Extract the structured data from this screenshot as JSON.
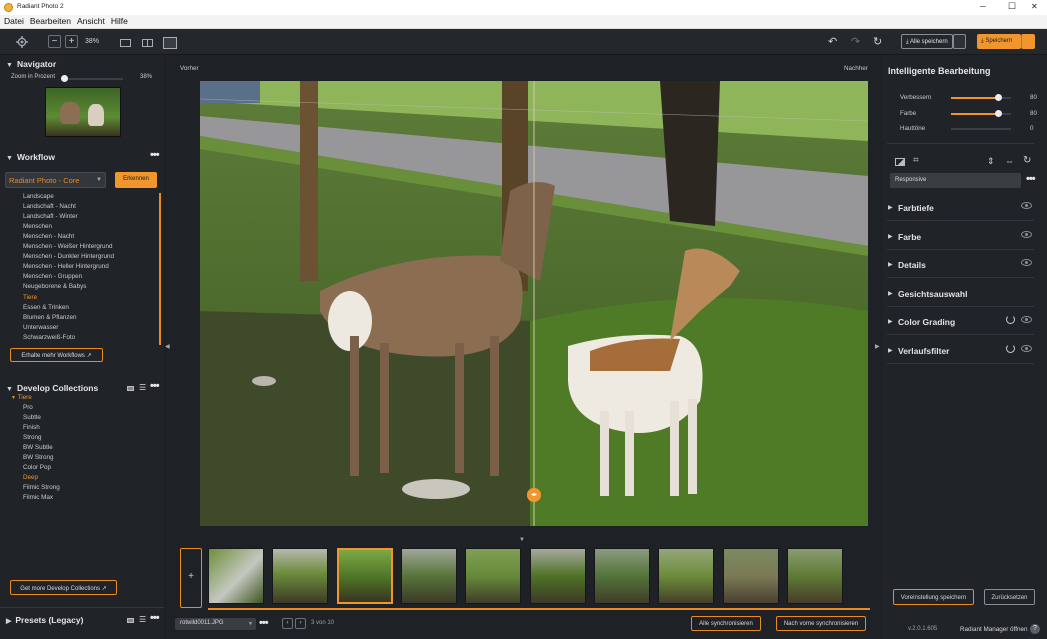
{
  "window": {
    "title": "Radiant Photo 2",
    "minimize": "─",
    "maximize": "☐",
    "close": "✕"
  },
  "menu": [
    "Datei",
    "Bearbeiten",
    "Ansicht",
    "Hilfe"
  ],
  "toolbar": {
    "zoom_minus": "−",
    "zoom_plus": "+",
    "zoom_value": "38%",
    "save_all_label": "Alle speichern",
    "save_label": "Speichern"
  },
  "navigator": {
    "title": "Navigator",
    "zoom_label": "Zoom in Prozent",
    "zoom_value": "38%",
    "zoom_fraction": 0.38
  },
  "workflow": {
    "title": "Workflow",
    "selected": "Radiant Photo - Core",
    "detect_button": "Erkennen",
    "items": [
      "Landscape",
      "Landschaft - Nacht",
      "Landschaft - Winter",
      "Menschen",
      "Menschen - Nacht",
      "Menschen - Weißer Hintergrund",
      "Menschen - Dunkler Hintergrund",
      "Menschen - Heller Hintergrund",
      "Menschen - Gruppen",
      "Neugeborene & Babys",
      "Tiere",
      "Essen & Trinken",
      "Blumen & Pflanzen",
      "Unterwasser",
      "Schwarzweiß-Foto"
    ],
    "active_item": "Tiere",
    "more_button": "Erhalte mehr Workflows"
  },
  "collections": {
    "title": "Develop Collections",
    "group": "Tiere",
    "items": [
      "Pro",
      "Subtle",
      "Finish",
      "Strong",
      "BW Subtle",
      "BW Strong",
      "Color Pop",
      "Deep",
      "Filmic Strong",
      "Filmic Max"
    ],
    "active_item": "Deep",
    "more_button": "Get more Develop Collections"
  },
  "presets": {
    "title": "Presets (Legacy)"
  },
  "viewer": {
    "before_label": "Vorher",
    "after_label": "Nachher"
  },
  "bottombar": {
    "file_name": "rotwild0011.JPG",
    "page_info": "3 von 10",
    "sync_all": "Alle synchronisieren",
    "sync_from_prev": "Nach vorne synchronisieren",
    "add_button": "+"
  },
  "right": {
    "title": "Intelligente Bearbeitung",
    "sliders": [
      {
        "label": "Verbessern",
        "value": "80",
        "fraction": 0.8
      },
      {
        "label": "Farbe",
        "value": "80",
        "fraction": 0.8
      },
      {
        "label": "Hauttöne",
        "value": "0",
        "fraction": 0
      }
    ],
    "profile": "Responsive",
    "sections": [
      "Farbtiefe",
      "Farbe",
      "Details",
      "Gesichtsauswahl",
      "Color Grading",
      "Verlaufsfilter"
    ],
    "save_preset": "Voreinstellung speichern",
    "reset": "Zurücksetzen",
    "version": "v.2.0.1.605",
    "manager": "Radiant Manager öffnen"
  }
}
